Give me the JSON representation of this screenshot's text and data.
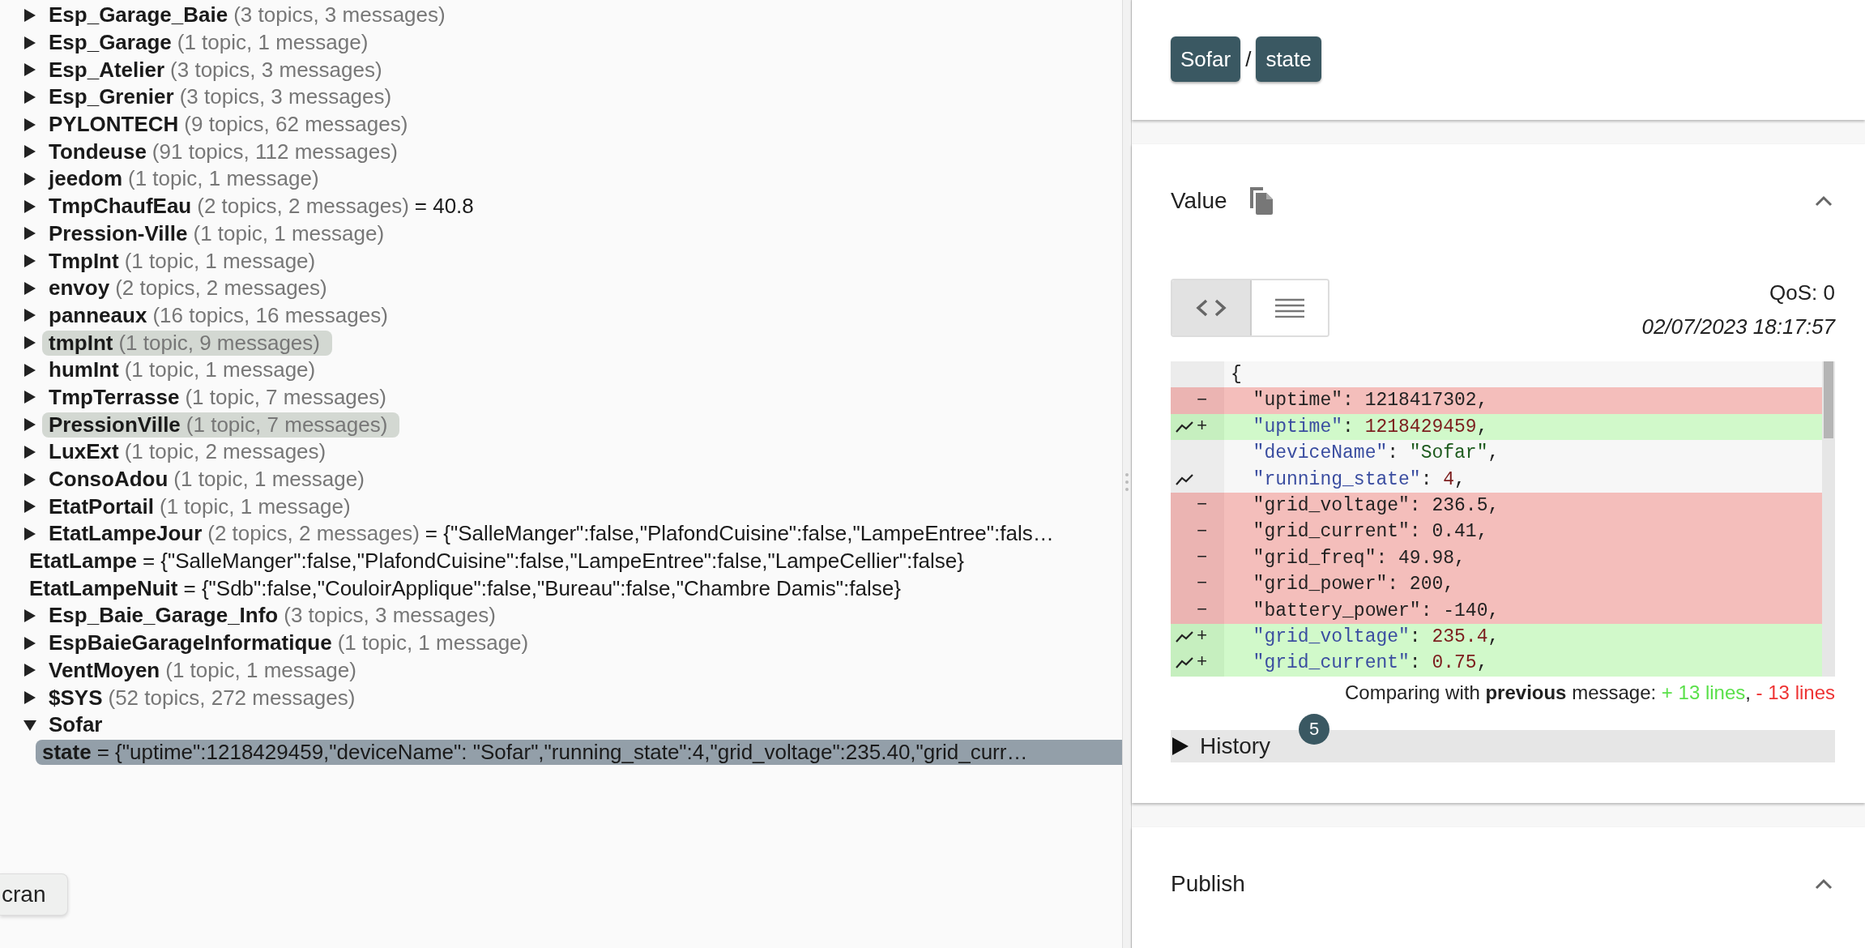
{
  "tree": [
    {
      "kind": "branch",
      "name": "Esp_Garage_Baie",
      "summary": "(3 topics, 3 messages)",
      "expanded": false,
      "highlighted": false,
      "selected": false
    },
    {
      "kind": "branch",
      "name": "Esp_Garage",
      "summary": "(1 topic, 1 message)",
      "expanded": false,
      "highlighted": false,
      "selected": false
    },
    {
      "kind": "branch",
      "name": "Esp_Atelier",
      "summary": "(3 topics, 3 messages)",
      "expanded": false,
      "highlighted": false,
      "selected": false
    },
    {
      "kind": "branch",
      "name": "Esp_Grenier",
      "summary": "(3 topics, 3 messages)",
      "expanded": false,
      "highlighted": false,
      "selected": false
    },
    {
      "kind": "branch",
      "name": "PYLONTECH",
      "summary": "(9 topics, 62 messages)",
      "expanded": false,
      "highlighted": false,
      "selected": false
    },
    {
      "kind": "branch",
      "name": "Tondeuse",
      "summary": "(91 topics, 112 messages)",
      "expanded": false,
      "highlighted": false,
      "selected": false
    },
    {
      "kind": "branch",
      "name": "jeedom",
      "summary": "(1 topic, 1 message)",
      "expanded": false,
      "highlighted": false,
      "selected": false
    },
    {
      "kind": "branch",
      "name": "TmpChaufEau",
      "summary": "(2 topics, 2 messages)",
      "value": "= 40.8",
      "expanded": false,
      "highlighted": false,
      "selected": false
    },
    {
      "kind": "branch",
      "name": "Pression-Ville",
      "summary": "(1 topic, 1 message)",
      "expanded": false,
      "highlighted": false,
      "selected": false
    },
    {
      "kind": "branch",
      "name": "TmpInt",
      "summary": "(1 topic, 1 message)",
      "expanded": false,
      "highlighted": false,
      "selected": false
    },
    {
      "kind": "branch",
      "name": "envoy",
      "summary": "(2 topics, 2 messages)",
      "expanded": false,
      "highlighted": false,
      "selected": false
    },
    {
      "kind": "branch",
      "name": "panneaux",
      "summary": "(16 topics, 16 messages)",
      "expanded": false,
      "highlighted": false,
      "selected": false
    },
    {
      "kind": "branch",
      "name": "tmpInt",
      "summary": "(1 topic, 9 messages)",
      "expanded": false,
      "highlighted": true,
      "selected": false
    },
    {
      "kind": "branch",
      "name": "humInt",
      "summary": "(1 topic, 1 message)",
      "expanded": false,
      "highlighted": false,
      "selected": false
    },
    {
      "kind": "branch",
      "name": "TmpTerrasse",
      "summary": "(1 topic, 7 messages)",
      "expanded": false,
      "highlighted": false,
      "selected": false
    },
    {
      "kind": "branch",
      "name": "PressionVille",
      "summary": "(1 topic, 7 messages)",
      "expanded": false,
      "highlighted": true,
      "selected": false
    },
    {
      "kind": "branch",
      "name": "LuxExt",
      "summary": "(1 topic, 2 messages)",
      "expanded": false,
      "highlighted": false,
      "selected": false
    },
    {
      "kind": "branch",
      "name": "ConsoAdou",
      "summary": "(1 topic, 1 message)",
      "expanded": false,
      "highlighted": false,
      "selected": false
    },
    {
      "kind": "branch",
      "name": "EtatPortail",
      "summary": "(1 topic, 1 message)",
      "expanded": false,
      "highlighted": false,
      "selected": false
    },
    {
      "kind": "branch",
      "name": "EtatLampeJour",
      "summary": "(2 topics, 2 messages)",
      "value": "= {\"SalleManger\":false,\"PlafondCuisine\":false,\"LampeEntree\":fals…",
      "expanded": false,
      "highlighted": false,
      "selected": false
    },
    {
      "kind": "leaf",
      "name": "EtatLampe",
      "value": "= {\"SalleManger\":false,\"PlafondCuisine\":false,\"LampeEntree\":false,\"LampeCellier\":false}",
      "highlighted": false,
      "selected": false
    },
    {
      "kind": "leaf",
      "name": "EtatLampeNuit",
      "value": "= {\"Sdb\":false,\"CouloirApplique\":false,\"Bureau\":false,\"Chambre Damis\":false}",
      "highlighted": false,
      "selected": false
    },
    {
      "kind": "branch",
      "name": "Esp_Baie_Garage_Info",
      "summary": "(3 topics, 3 messages)",
      "expanded": false,
      "highlighted": false,
      "selected": false
    },
    {
      "kind": "branch",
      "name": "EspBaieGarageInformatique",
      "summary": "(1 topic, 1 message)",
      "expanded": false,
      "highlighted": false,
      "selected": false
    },
    {
      "kind": "branch",
      "name": "VentMoyen",
      "summary": "(1 topic, 1 message)",
      "expanded": false,
      "highlighted": false,
      "selected": false
    },
    {
      "kind": "branch",
      "name": "$SYS",
      "summary": "(52 topics, 272 messages)",
      "expanded": false,
      "highlighted": false,
      "selected": false
    },
    {
      "kind": "branch",
      "name": "Sofar",
      "expanded": true,
      "highlighted": false,
      "selected": false,
      "children": [
        {
          "kind": "leaf",
          "name": "state",
          "value": "= {\"uptime\":1218429459,\"deviceName\": \"Sofar\",\"running_state\":4,\"grid_voltage\":235.40,\"grid_curr…",
          "highlighted": false,
          "selected": true
        }
      ]
    }
  ],
  "floating_button": {
    "label": "cran"
  },
  "breadcrumb": {
    "parts": [
      "Sofar",
      "state"
    ],
    "separator": "/"
  },
  "value_panel": {
    "title": "Value",
    "view_toggle": [
      {
        "kind": "code",
        "selected": true
      },
      {
        "kind": "lines",
        "selected": false
      }
    ],
    "qos": "QoS: 0",
    "timestamp": "02/07/2023 18:17:57",
    "diff_lines": [
      {
        "kind": "context",
        "trend": false,
        "parts": [
          {
            "text": "{",
            "kind": "punct"
          }
        ]
      },
      {
        "kind": "removed",
        "mark": "−",
        "trend": false,
        "parts": [
          {
            "text": "  \"uptime\"",
            "kind": "key"
          },
          {
            "text": ": ",
            "kind": "punct"
          },
          {
            "text": "1218417302",
            "kind": "number"
          },
          {
            "text": ",",
            "kind": "punct"
          }
        ]
      },
      {
        "kind": "added",
        "mark": "+",
        "trend": true,
        "parts": [
          {
            "text": "  \"uptime\"",
            "kind": "key"
          },
          {
            "text": ": ",
            "kind": "punct"
          },
          {
            "text": "1218429459",
            "kind": "number"
          },
          {
            "text": ",",
            "kind": "punct"
          }
        ]
      },
      {
        "kind": "context",
        "trend": false,
        "parts": [
          {
            "text": "  \"deviceName\"",
            "kind": "key"
          },
          {
            "text": ": ",
            "kind": "punct"
          },
          {
            "text": "\"Sofar\"",
            "kind": "string"
          },
          {
            "text": ",",
            "kind": "punct"
          }
        ]
      },
      {
        "kind": "context",
        "trend": true,
        "parts": [
          {
            "text": "  \"running_state\"",
            "kind": "key"
          },
          {
            "text": ": ",
            "kind": "punct"
          },
          {
            "text": "4",
            "kind": "number"
          },
          {
            "text": ",",
            "kind": "punct"
          }
        ]
      },
      {
        "kind": "removed",
        "mark": "−",
        "trend": false,
        "parts": [
          {
            "text": "  \"grid_voltage\"",
            "kind": "key"
          },
          {
            "text": ": ",
            "kind": "punct"
          },
          {
            "text": "236.5",
            "kind": "number"
          },
          {
            "text": ",",
            "kind": "punct"
          }
        ]
      },
      {
        "kind": "removed",
        "mark": "−",
        "trend": false,
        "parts": [
          {
            "text": "  \"grid_current\"",
            "kind": "key"
          },
          {
            "text": ": ",
            "kind": "punct"
          },
          {
            "text": "0.41",
            "kind": "number"
          },
          {
            "text": ",",
            "kind": "punct"
          }
        ]
      },
      {
        "kind": "removed",
        "mark": "−",
        "trend": false,
        "parts": [
          {
            "text": "  \"grid_freq\"",
            "kind": "key"
          },
          {
            "text": ": ",
            "kind": "punct"
          },
          {
            "text": "49.98",
            "kind": "number"
          },
          {
            "text": ",",
            "kind": "punct"
          }
        ]
      },
      {
        "kind": "removed",
        "mark": "−",
        "trend": false,
        "parts": [
          {
            "text": "  \"grid_power\"",
            "kind": "key"
          },
          {
            "text": ": ",
            "kind": "punct"
          },
          {
            "text": "200",
            "kind": "number"
          },
          {
            "text": ",",
            "kind": "punct"
          }
        ]
      },
      {
        "kind": "removed",
        "mark": "−",
        "trend": false,
        "parts": [
          {
            "text": "  \"battery_power\"",
            "kind": "key"
          },
          {
            "text": ": ",
            "kind": "punct"
          },
          {
            "text": "-140",
            "kind": "number"
          },
          {
            "text": ",",
            "kind": "punct"
          }
        ]
      },
      {
        "kind": "added",
        "mark": "+",
        "trend": true,
        "parts": [
          {
            "text": "  \"grid_voltage\"",
            "kind": "key"
          },
          {
            "text": ": ",
            "kind": "punct"
          },
          {
            "text": "235.4",
            "kind": "number"
          },
          {
            "text": ",",
            "kind": "punct"
          }
        ]
      },
      {
        "kind": "added",
        "mark": "+",
        "trend": true,
        "parts": [
          {
            "text": "  \"grid_current\"",
            "kind": "key"
          },
          {
            "text": ": ",
            "kind": "punct"
          },
          {
            "text": "0.75",
            "kind": "number"
          },
          {
            "text": ",",
            "kind": "punct"
          }
        ]
      }
    ],
    "comparison": {
      "text": "Comparing with **previous** message:",
      "added": "+ 13 lines",
      "separator": ",",
      "removed": "- 13 lines"
    },
    "history": {
      "label": "History",
      "count": "5",
      "expanded": false
    }
  },
  "publish_panel": {
    "title": "Publish"
  }
}
